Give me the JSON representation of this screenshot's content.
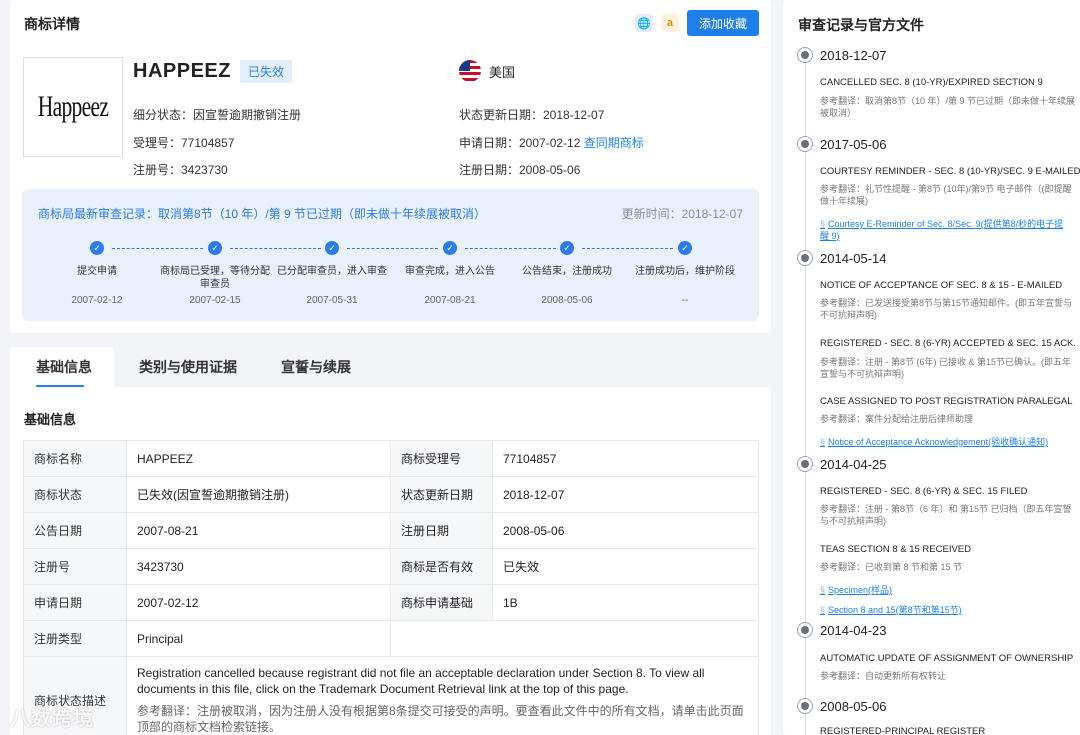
{
  "detail": {
    "title": "商标详情",
    "favorite_label": "添加收藏",
    "logo_text": "Happeez",
    "name": "HAPPEEZ",
    "status_tag": "已失效",
    "country": "美国",
    "detailed_status": "细分状态：因宣誓逾期撤销注册",
    "application_no": "受理号：77104857",
    "registration_no": "注册号：3423730",
    "status_update": "状态更新日期：2018-12-07",
    "apply_date": "申请日期：2007-02-12",
    "same_period_link": "查同期商标",
    "reg_date": "注册日期：2008-05-06"
  },
  "progress": {
    "latest": "商标局最新审查记录：取消第8节（10 年）/第 9 节已过期（即未做十年续展被取消）",
    "update_time": "更新时间：2018-12-07",
    "steps": [
      {
        "label": "提交申请",
        "date": "2007-02-12"
      },
      {
        "label": "商标局已受理，等待分配审查员",
        "date": "2007-02-15"
      },
      {
        "label": "已分配审查员，进入审查",
        "date": "2007-05-31"
      },
      {
        "label": "审查完成，进入公告",
        "date": "2007-08-21"
      },
      {
        "label": "公告结束，注册成功",
        "date": "2008-05-06"
      },
      {
        "label": "注册成功后，维护阶段",
        "date": "--"
      }
    ]
  },
  "tabs": [
    "基础信息",
    "类别与使用证据",
    "宣誓与续展"
  ],
  "basic": {
    "section_title": "基础信息",
    "rows": [
      [
        "商标名称",
        "HAPPEEZ",
        "商标受理号",
        "77104857"
      ],
      [
        "商标状态",
        "已失效(因宣誓逾期撤销注册)",
        "状态更新日期",
        "2018-12-07"
      ],
      [
        "公告日期",
        "2007-08-21",
        "注册日期",
        "2008-05-06"
      ],
      [
        "注册号",
        "3423730",
        "商标是否有效",
        "已失效"
      ],
      [
        "申请日期",
        "2007-02-12",
        "商标申请基础",
        "1B"
      ],
      [
        "注册类型",
        "Principal",
        "",
        ""
      ]
    ],
    "desc_label": "商标状态描述",
    "desc_text": "Registration cancelled because registrant did not file an acceptable declaration under Section 8. To view all documents in this file, click on the Trademark Document Retrieval link at the top of this page.",
    "desc_ref": "参考翻译：注册被取消，因为注册人没有根据第8条提交可接受的声明。要查看此文件中的所有文档，请单击此页面顶部的商标文档检索链接。"
  },
  "watermark": "八数跨境",
  "records": {
    "title": "审查记录与官方文件",
    "groups": [
      {
        "date": "2018-12-07",
        "items": [
          {
            "event": "CANCELLED SEC. 8 (10-YR)/EXPIRED SECTION 9",
            "ref": "参考翻译：取消第8节（10 年）/第 9 节已过期（即未做十年续展被取消）"
          }
        ]
      },
      {
        "date": "2017-05-06",
        "items": [
          {
            "event": "COURTESY REMINDER - SEC. 8 (10-YR)/SEC. 9 E-MAILED",
            "ref": "参考翻译：礼节性提醒 - 第8节 (10年)/第9节 电子邮件（(即提醒做十年续展)",
            "link": "Courtesy E-Reminder of Sec. 8/Sec. 9(提供第8/秒的电子提醒 9)"
          }
        ]
      },
      {
        "date": "2014-05-14",
        "items": [
          {
            "event": "NOTICE OF ACCEPTANCE OF SEC. 8 & 15 - E-MAILED",
            "ref": "参考翻译：已发送接受第8节与第15节通知邮件。(即五年宣誓与不可抗辩声明)"
          },
          {
            "event": "REGISTERED - SEC. 8 (6-YR) ACCEPTED & SEC. 15 ACK.",
            "ref": "参考翻译：注册 - 第8节 (6年) 已接收 & 第15节已确认。(即五年宣誓与不可抗辩声明)"
          },
          {
            "event": "CASE ASSIGNED TO POST REGISTRATION PARALEGAL",
            "ref": "参考翻译：案件分配给注册后律师助理",
            "link": "Notice of Acceptance Acknowledgement(验收确认通知)"
          }
        ]
      },
      {
        "date": "2014-04-25",
        "items": [
          {
            "event": "REGISTERED - SEC. 8 (6-YR) & SEC. 15 FILED",
            "ref": "参考翻译：注册 - 第8节（6 年）和 第15节 已归档（即五年宣誓与不可抗辩声明)"
          },
          {
            "event": "TEAS SECTION 8 & 15 RECEIVED",
            "ref": "参考翻译：已收到第 8 节和第 15 节",
            "link": "Specimen(样品)",
            "link2": "Section 8 and 15(第8节和第15节)"
          }
        ]
      },
      {
        "date": "2014-04-23",
        "items": [
          {
            "event": "AUTOMATIC UPDATE OF ASSIGNMENT OF OWNERSHIP",
            "ref": "参考翻译：自动更新所有权转让"
          }
        ]
      },
      {
        "date": "2008-05-06",
        "items": [
          {
            "event": "REGISTERED-PRINCIPAL REGISTER",
            "ref": ""
          }
        ]
      }
    ]
  }
}
